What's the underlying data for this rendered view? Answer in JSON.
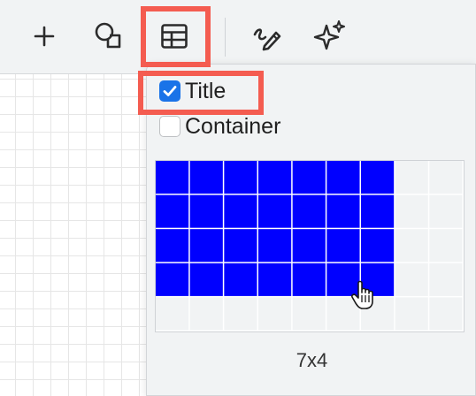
{
  "toolbar": {
    "buttons": [
      {
        "id": "add",
        "icon": "plus-icon"
      },
      {
        "id": "shapes",
        "icon": "shapes-icon"
      },
      {
        "id": "table",
        "icon": "table-icon"
      },
      {
        "id": "freehand",
        "icon": "freehand-pen-icon"
      },
      {
        "id": "generate",
        "icon": "sparkles-icon"
      }
    ]
  },
  "table_popup": {
    "options": [
      {
        "label": "Title",
        "checked": true
      },
      {
        "label": "Container",
        "checked": false
      }
    ],
    "grid": {
      "columns": 9,
      "rows": 5,
      "selected_columns": 7,
      "selected_rows": 4
    },
    "size_label": "7x4"
  },
  "colors": {
    "selected_cell": "#0000ff",
    "empty_cell": "#f1f3f4",
    "highlight": "#f45c50",
    "checkbox_checked": "#1a73e8"
  }
}
